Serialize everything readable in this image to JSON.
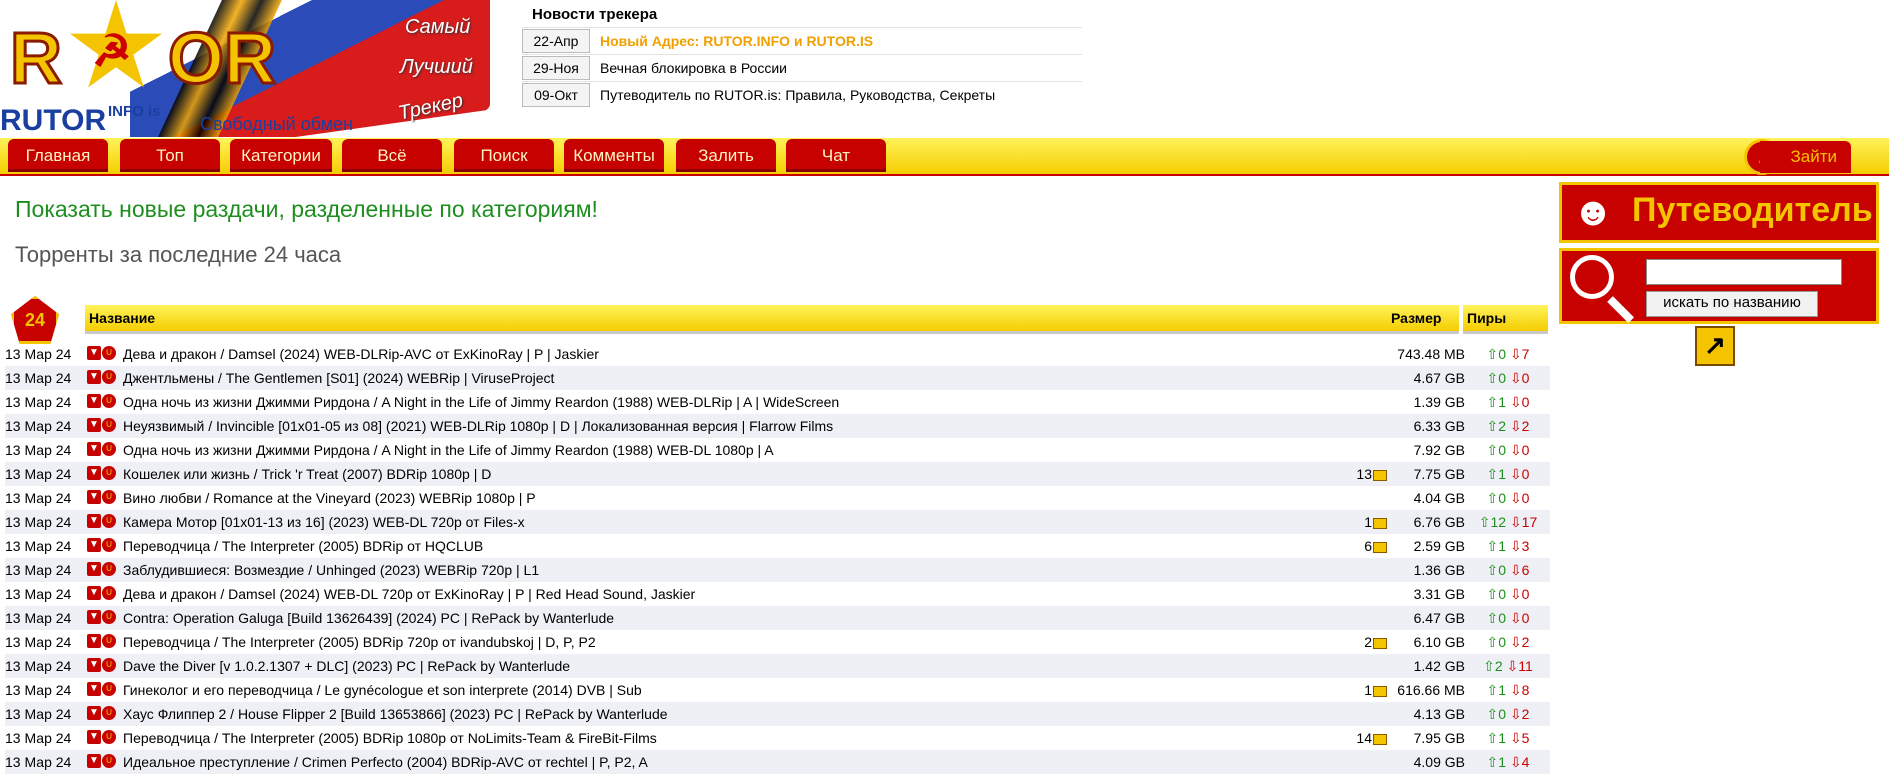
{
  "logo": {
    "letters_left": "R",
    "letters_right": "OR",
    "word1": "Самый",
    "word2": "Лучший",
    "word3": "Трекер",
    "name": "RUTOR",
    "suffix": "INFO is",
    "slogan": "Свободный обмен"
  },
  "news": {
    "title": "Новости трекера",
    "items": [
      {
        "date": "22-Апр",
        "text": "Новый Адрес: RUTOR.INFO и RUTOR.IS"
      },
      {
        "date": "29-Ноя",
        "text": "Вечная блокировка в России"
      },
      {
        "date": "09-Окт",
        "text": "Путеводитель по RUTOR.is: Правила, Руководства, Секреты"
      }
    ]
  },
  "menu": [
    {
      "label": "Главная"
    },
    {
      "label": "Топ"
    },
    {
      "label": "Категории"
    },
    {
      "label": "Всё"
    },
    {
      "label": "Поиск"
    },
    {
      "label": "Комменты"
    },
    {
      "label": "Залить"
    },
    {
      "label": "Чат"
    }
  ],
  "login": {
    "label": "Зайти"
  },
  "headings": {
    "categories_link": "Показать новые раздачи, разделенные по категориям!",
    "last24": "Торренты за последние 24 часа"
  },
  "table": {
    "badge": "24",
    "headers": {
      "name": "Название",
      "size": "Размер",
      "peers": "Пиры"
    },
    "rows": [
      {
        "date": "13 Мар 24",
        "name": "Дева и дракон / Damsel (2024) WEB-DLRip-AVC от ExKinoRay | P | Jaskier",
        "comments": "",
        "size": "743.48 MB",
        "up": "0",
        "down": "7"
      },
      {
        "date": "13 Мар 24",
        "name": "Джентльмены / The Gentlemen [S01] (2024) WEBRip | ViruseProject",
        "comments": "",
        "size": "4.67 GB",
        "up": "0",
        "down": "0"
      },
      {
        "date": "13 Мар 24",
        "name": "Одна ночь из жизни Джимми Рирдона / A Night in the Life of Jimmy Reardon (1988) WEB-DLRip | A | WideScreen",
        "comments": "",
        "size": "1.39 GB",
        "up": "1",
        "down": "0"
      },
      {
        "date": "13 Мар 24",
        "name": "Неуязвимый / Invincible [01x01-05 из 08] (2021) WEB-DLRip 1080p | D | Локализованная версия | Flarrow Films",
        "comments": "",
        "size": "6.33 GB",
        "up": "2",
        "down": "2"
      },
      {
        "date": "13 Мар 24",
        "name": "Одна ночь из жизни Джимми Рирдона / A Night in the Life of Jimmy Reardon (1988) WEB-DL 1080p | A",
        "comments": "",
        "size": "7.92 GB",
        "up": "0",
        "down": "0"
      },
      {
        "date": "13 Мар 24",
        "name": "Кошелек или жизнь / Trick 'r Treat (2007) BDRip 1080p | D",
        "comments": "13",
        "size": "7.75 GB",
        "up": "1",
        "down": "0"
      },
      {
        "date": "13 Мар 24",
        "name": "Вино любви / Romance at the Vineyard (2023) WEBRip 1080p | P",
        "comments": "",
        "size": "4.04 GB",
        "up": "0",
        "down": "0"
      },
      {
        "date": "13 Мар 24",
        "name": "Камера Мотор [01x01-13 из 16] (2023) WEB-DL 720p от Files-x",
        "comments": "1",
        "size": "6.76 GB",
        "up": "12",
        "down": "17"
      },
      {
        "date": "13 Мар 24",
        "name": "Переводчица / The Interpreter (2005) BDRip от HQCLUB",
        "comments": "6",
        "size": "2.59 GB",
        "up": "1",
        "down": "3"
      },
      {
        "date": "13 Мар 24",
        "name": "Заблудившиеся: Возмездие / Unhinged (2023) WEBRip 720p | L1",
        "comments": "",
        "size": "1.36 GB",
        "up": "0",
        "down": "6"
      },
      {
        "date": "13 Мар 24",
        "name": "Дева и дракон / Damsel (2024) WEB-DL 720p от ExKinoRay | P | Red Head Sound, Jaskier",
        "comments": "",
        "size": "3.31 GB",
        "up": "0",
        "down": "0"
      },
      {
        "date": "13 Мар 24",
        "name": "Contra: Operation Galuga [Build 13626439] (2024) PC | RePack by Wanterlude",
        "comments": "",
        "size": "6.47 GB",
        "up": "0",
        "down": "0"
      },
      {
        "date": "13 Мар 24",
        "name": "Переводчица / The Interpreter (2005) BDRip 720p от ivandubskoj | D, P, P2",
        "comments": "2",
        "size": "6.10 GB",
        "up": "0",
        "down": "2"
      },
      {
        "date": "13 Мар 24",
        "name": "Dave the Diver [v 1.0.2.1307 + DLC] (2023) PC | RePack by Wanterlude",
        "comments": "",
        "size": "1.42 GB",
        "up": "2",
        "down": "11"
      },
      {
        "date": "13 Мар 24",
        "name": "Гинеколог и его переводчица / Le gynécologue et son interprete (2014) DVB | Sub",
        "comments": "1",
        "size": "616.66 MB",
        "up": "1",
        "down": "8"
      },
      {
        "date": "13 Мар 24",
        "name": "Хаус Флиппер 2 / House Flipper 2 [Build 13653866] (2023) PC | RePack by Wanterlude",
        "comments": "",
        "size": "4.13 GB",
        "up": "0",
        "down": "2"
      },
      {
        "date": "13 Мар 24",
        "name": "Переводчица / The Interpreter (2005) BDRip 1080p от NoLimits-Team & FireBit-Films",
        "comments": "14",
        "size": "7.95 GB",
        "up": "1",
        "down": "5"
      },
      {
        "date": "13 Мар 24",
        "name": "Идеальное преступление / Crimen Perfecto (2004) BDRip-AVC от rechtel | P, P2, A",
        "comments": "",
        "size": "4.09 GB",
        "up": "1",
        "down": "4"
      }
    ]
  },
  "sidebar": {
    "guide_label": "Путеводитель",
    "search_button": "искать по названию",
    "search_value": ""
  }
}
